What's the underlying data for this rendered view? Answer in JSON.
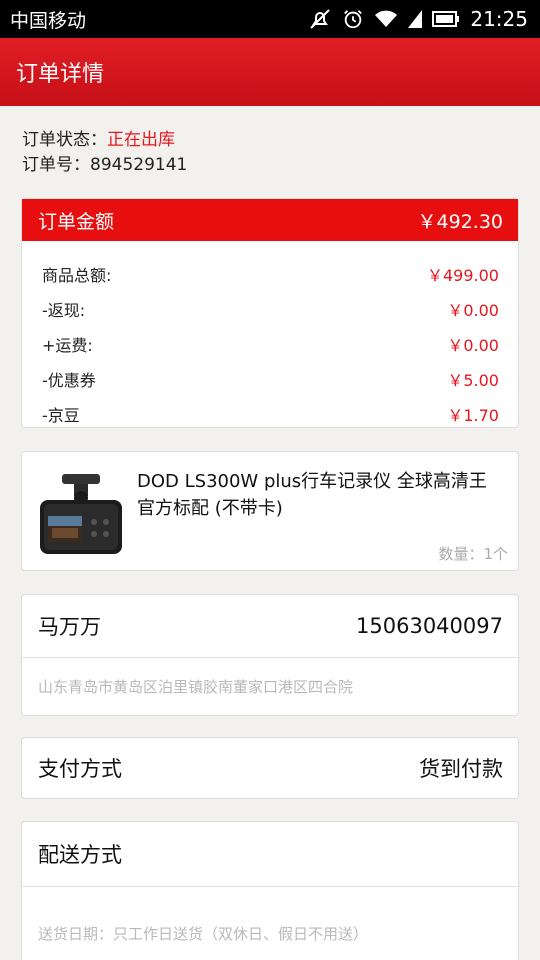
{
  "status_bar": {
    "carrier": "中国移动",
    "time": "21:25"
  },
  "header": {
    "title": "订单详情"
  },
  "order": {
    "status_label": "订单状态：",
    "status_value": "正在出库",
    "number_label": "订单号：",
    "number_value": "894529141"
  },
  "amount": {
    "title": "订单金额",
    "total": "￥492.30",
    "rows": [
      {
        "label": "商品总额:",
        "value": "￥499.00"
      },
      {
        "label": "-返现:",
        "value": "￥0.00"
      },
      {
        "label": "+运费:",
        "value": "￥0.00"
      },
      {
        "label": "-优惠券",
        "value": "￥5.00"
      },
      {
        "label": "-京豆",
        "value": "￥1.70"
      }
    ]
  },
  "product": {
    "title": "DOD LS300W plus行车记录仪 全球高清王 官方标配 (不带卡)",
    "quantity": "数量：1个",
    "image_icon": "dashcam-product-image"
  },
  "address": {
    "name": "马万万",
    "phone": "15063040097",
    "detail": "山东青岛市黄岛区泊里镇胶南董家口港区四合院"
  },
  "payment": {
    "label": "支付方式",
    "value": "货到付款"
  },
  "shipping": {
    "label": "配送方式",
    "date": "送货日期：只工作日送货（双休日、假日不用送）"
  },
  "colors": {
    "brand_red": "#e60e0e",
    "price_red": "#e5161e",
    "muted_gray": "#b9b9b9"
  }
}
